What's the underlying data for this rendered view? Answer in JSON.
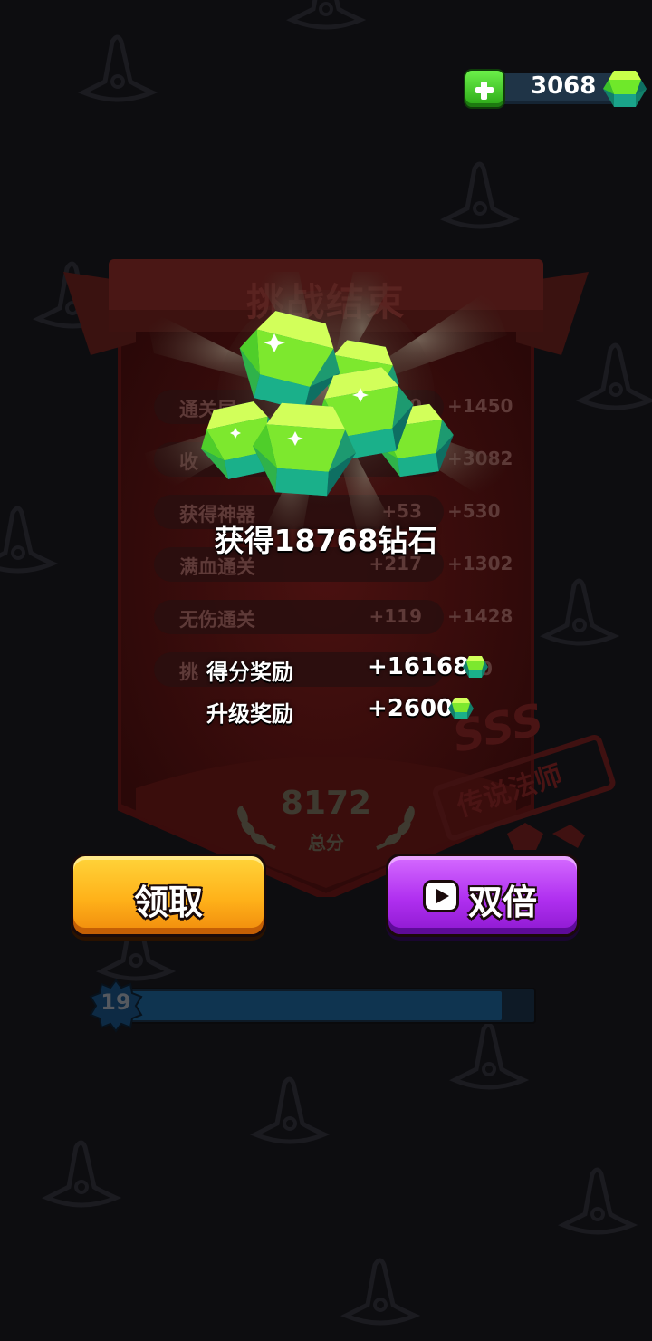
{
  "currency": {
    "gems": "3068"
  },
  "panel": {
    "title": "挑战结束",
    "rows": [
      {
        "label": "通关层",
        "mid": "0",
        "right": "+1450"
      },
      {
        "label": "收",
        "mid": "",
        "right": "+3082"
      },
      {
        "label": "获得神器",
        "mid": "+53",
        "right": "+530"
      },
      {
        "label": "满血通关",
        "mid": "+217",
        "right": "+1302"
      },
      {
        "label": "无伤通关",
        "mid": "+119",
        "right": "+1428"
      },
      {
        "label": "挑",
        "mid": "",
        "right": "0"
      }
    ],
    "stamp_grade": "SSS",
    "stamp_rank": "传说法师",
    "total_score": "8172",
    "total_label": "总分"
  },
  "reward": {
    "title": "获得18768钻石",
    "score_bonus_label": "得分奖励",
    "score_bonus_value": "+16168",
    "level_bonus_label": "升级奖励",
    "level_bonus_value": "+2600"
  },
  "buttons": {
    "claim": "领取",
    "double": "双倍"
  },
  "level": {
    "number": "19",
    "progress": 0.92
  },
  "colors": {
    "gem_light": "#b8ff3a",
    "gem_mid": "#4fd02a",
    "gem_dark": "#12806a",
    "claim_button": "#ffb21a",
    "double_button": "#b030f0"
  }
}
